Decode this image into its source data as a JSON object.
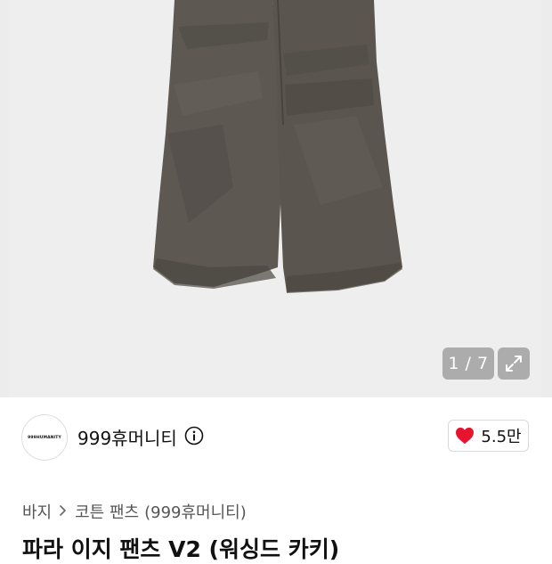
{
  "gallery": {
    "counter": "1 / 7",
    "expand_icon": "expand-icon",
    "product_color": "#5f5a53"
  },
  "brand": {
    "logo_text": "999HUMANITY",
    "name": "999휴머니티",
    "info_icon": "info-icon"
  },
  "like": {
    "icon": "heart-icon",
    "count": "5.5만",
    "heart_color": "#e8132f"
  },
  "breadcrumb": {
    "category": "바지",
    "subcategory": "코튼 팬츠",
    "brand": "(999휴머니티)"
  },
  "product": {
    "title": "파라 이지 팬츠 V2 (워싱드 카키)"
  }
}
